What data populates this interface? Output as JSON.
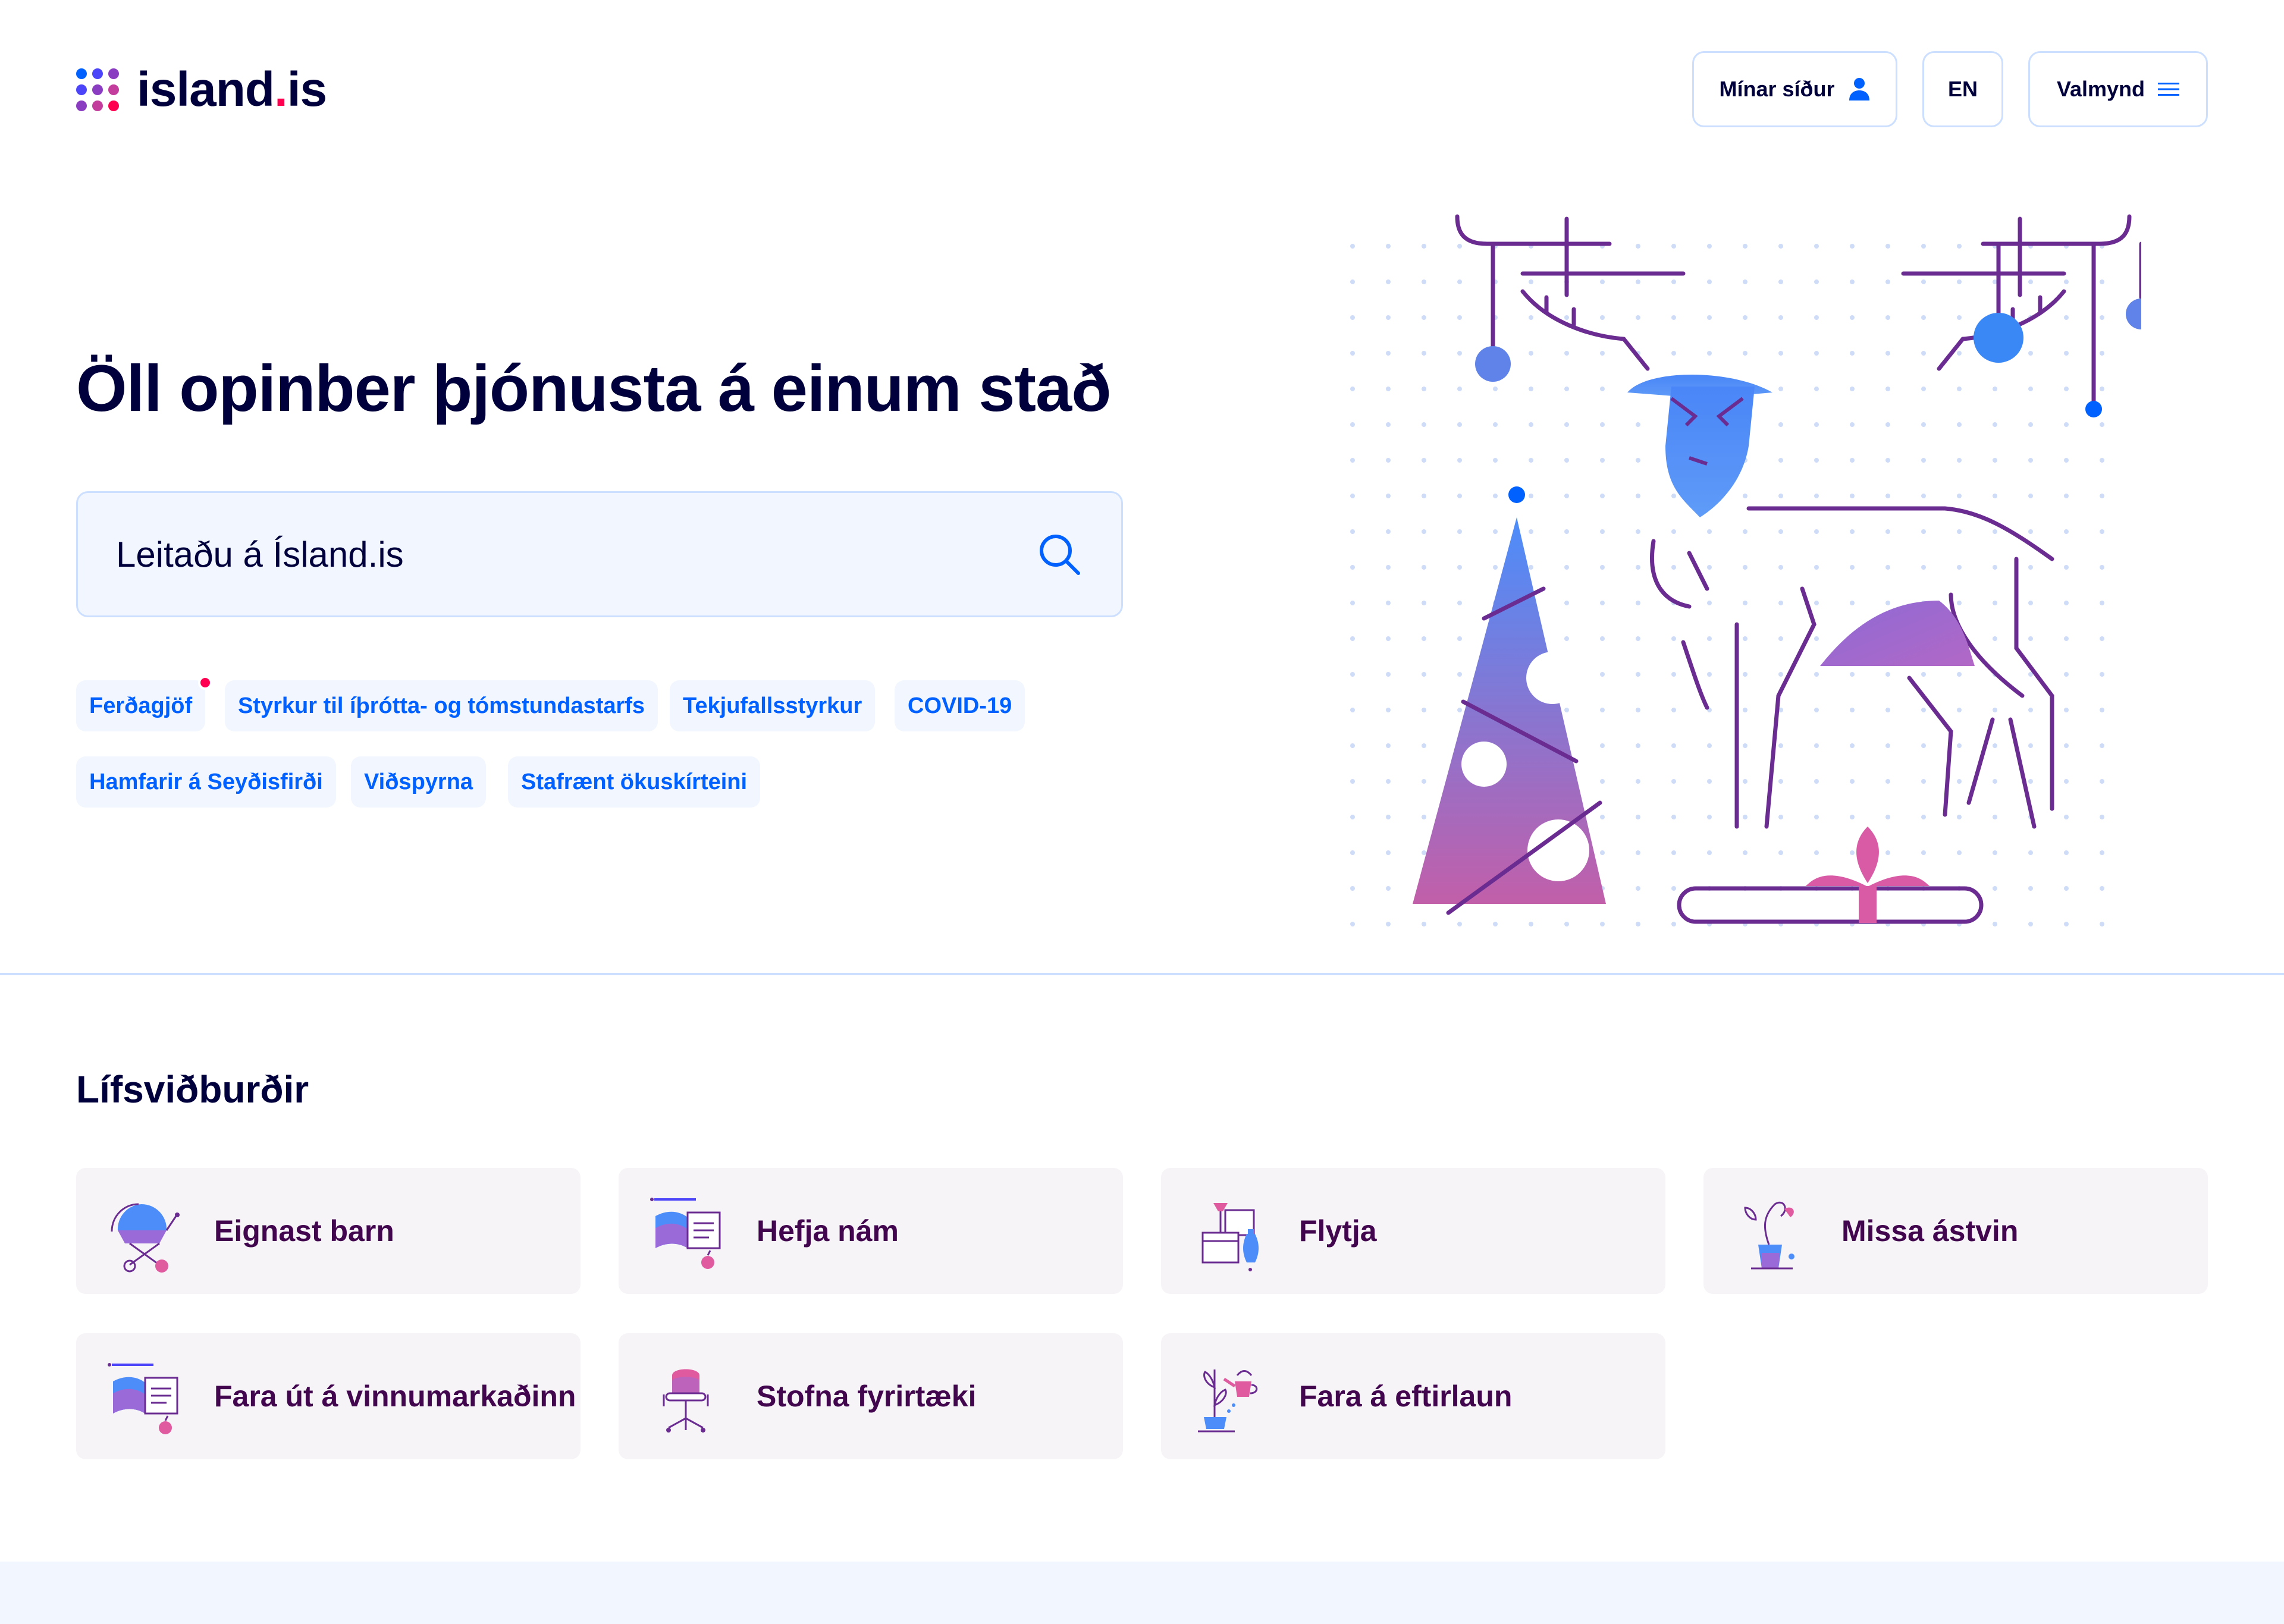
{
  "brand": {
    "name_main": "island",
    "name_dot": ".",
    "name_tld": "is",
    "dot_colors": [
      "#0061ff",
      "#4c44f9",
      "#8a3dc0",
      "#4c44f9",
      "#8a3dc0",
      "#c33d9c",
      "#8a3dc0",
      "#c33d9c",
      "#ff0050"
    ]
  },
  "header": {
    "my_pages_label": "Mínar síður",
    "language_label": "EN",
    "menu_label": "Valmynd"
  },
  "hero": {
    "title": "Öll opinber þjónusta á einum stað",
    "search_placeholder": "Leitaðu á Ísland.is"
  },
  "tags": [
    {
      "label": "Ferðagjöf",
      "has_badge": true
    },
    {
      "label": "Styrkur til íþrótta- og tómstundastarfs"
    },
    {
      "label": "Tekjufallsstyrkur"
    },
    {
      "label": "COVID-19"
    },
    {
      "label": "Hamfarir á Seyðisfirði"
    },
    {
      "label": "Viðspyrna"
    },
    {
      "label": "Stafrænt ökuskírteini"
    }
  ],
  "life_events": {
    "title": "Lífsviðburðir",
    "items": [
      {
        "label": "Eignast barn",
        "icon": "stroller-icon"
      },
      {
        "label": "Hefja nám",
        "icon": "book-icon"
      },
      {
        "label": "Flytja",
        "icon": "moving-boxes-icon"
      },
      {
        "label": "Missa ástvin",
        "icon": "flower-pot-icon"
      },
      {
        "label": "Fara út á vinnumarkaðinn",
        "icon": "book-apple-icon"
      },
      {
        "label": "Stofna fyrirtæki",
        "icon": "office-chair-icon"
      },
      {
        "label": "Fara á eftirlaun",
        "icon": "watering-can-icon"
      }
    ]
  },
  "colors": {
    "primary_blue": "#0061ff",
    "dark_navy": "#00003c",
    "purple": "#42064f",
    "accent_red": "#ff0050",
    "light_blue_bg": "#f2f7ff",
    "border_blue": "#ccdfff",
    "card_bg": "#f6f4f7",
    "illustration_stroke": "#6a2c91"
  }
}
